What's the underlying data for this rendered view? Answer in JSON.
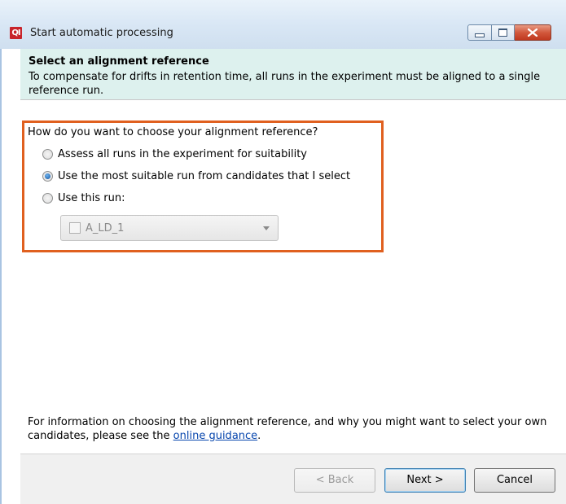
{
  "window": {
    "title": "Start automatic processing",
    "logo_text": "QI"
  },
  "header": {
    "title": "Select an alignment reference",
    "description": "To compensate for drifts in retention time, all runs in the experiment must be aligned to a single reference run."
  },
  "question": "How do you want to choose your alignment reference?",
  "options": [
    {
      "label": "Assess all runs in the experiment for suitability",
      "checked": false
    },
    {
      "label": "Use the most suitable run from candidates that I select",
      "checked": true
    },
    {
      "label": "Use this run:",
      "checked": false
    }
  ],
  "run_select": {
    "value": "A_LD_1",
    "enabled": false
  },
  "info": {
    "text_before": "For information on choosing the alignment reference, and why you might want to select your own candidates, please see the ",
    "link_text": "online guidance",
    "text_after": "."
  },
  "buttons": {
    "back": "< Back",
    "next": "Next >",
    "cancel": "Cancel"
  },
  "colors": {
    "header_bg": "#ddf1ee",
    "highlight_border": "#e0601f",
    "link": "#0645ad"
  }
}
